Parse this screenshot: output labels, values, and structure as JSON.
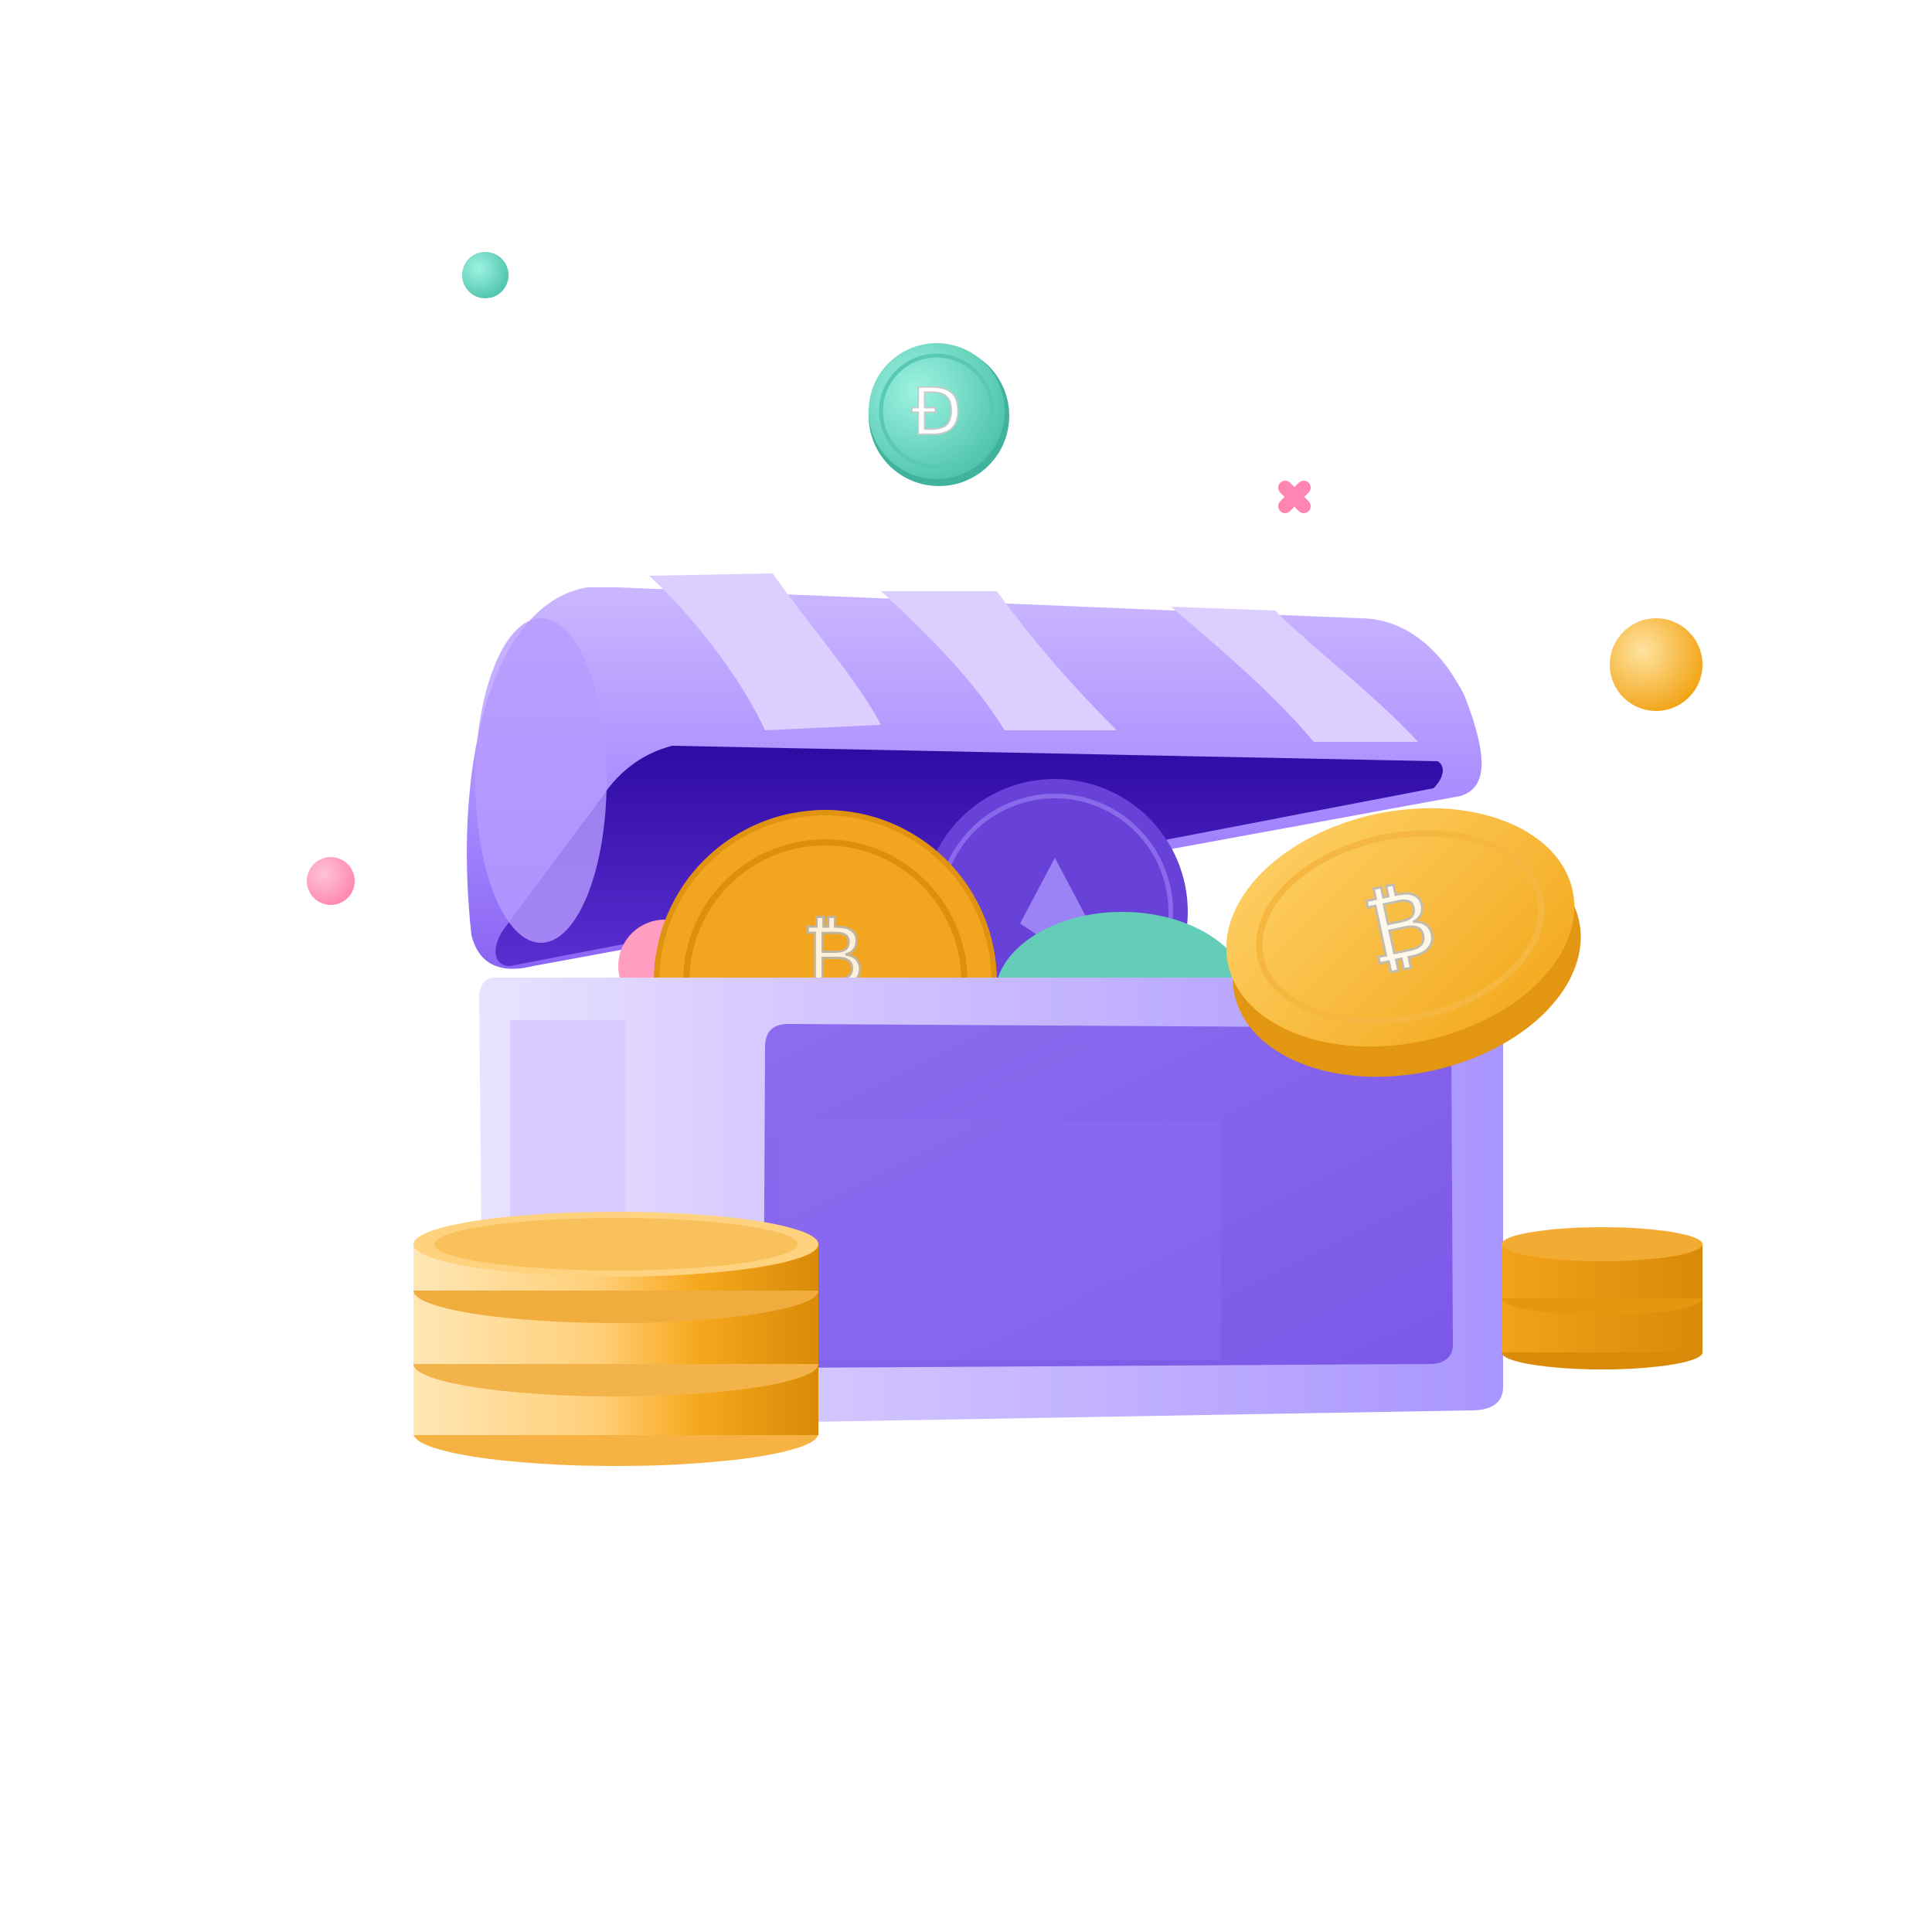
{
  "scene": {
    "subject": "crypto-treasure-chest-illustration",
    "coins": [
      {
        "kind": "dash-coin",
        "symbol": "Đ"
      },
      {
        "kind": "bitcoin-coin",
        "symbol": "₿"
      },
      {
        "kind": "bitcoin-coin",
        "symbol": "₿"
      },
      {
        "kind": "ethereum-coin",
        "symbol": "Ξ"
      }
    ]
  },
  "colors": {
    "background": "#ffffff",
    "chest_purple_light": "#c9b8ff",
    "chest_purple_mid": "#9a7cf2",
    "chest_purple_dark": "#3a13a8",
    "gold_light": "#ffd27a",
    "gold": "#f4a71f",
    "gold_dark": "#d88a08",
    "teal": "#69d6c2",
    "teal_dark": "#3fb7a1",
    "pink": "#ff8fb8",
    "white": "#ffffff"
  }
}
